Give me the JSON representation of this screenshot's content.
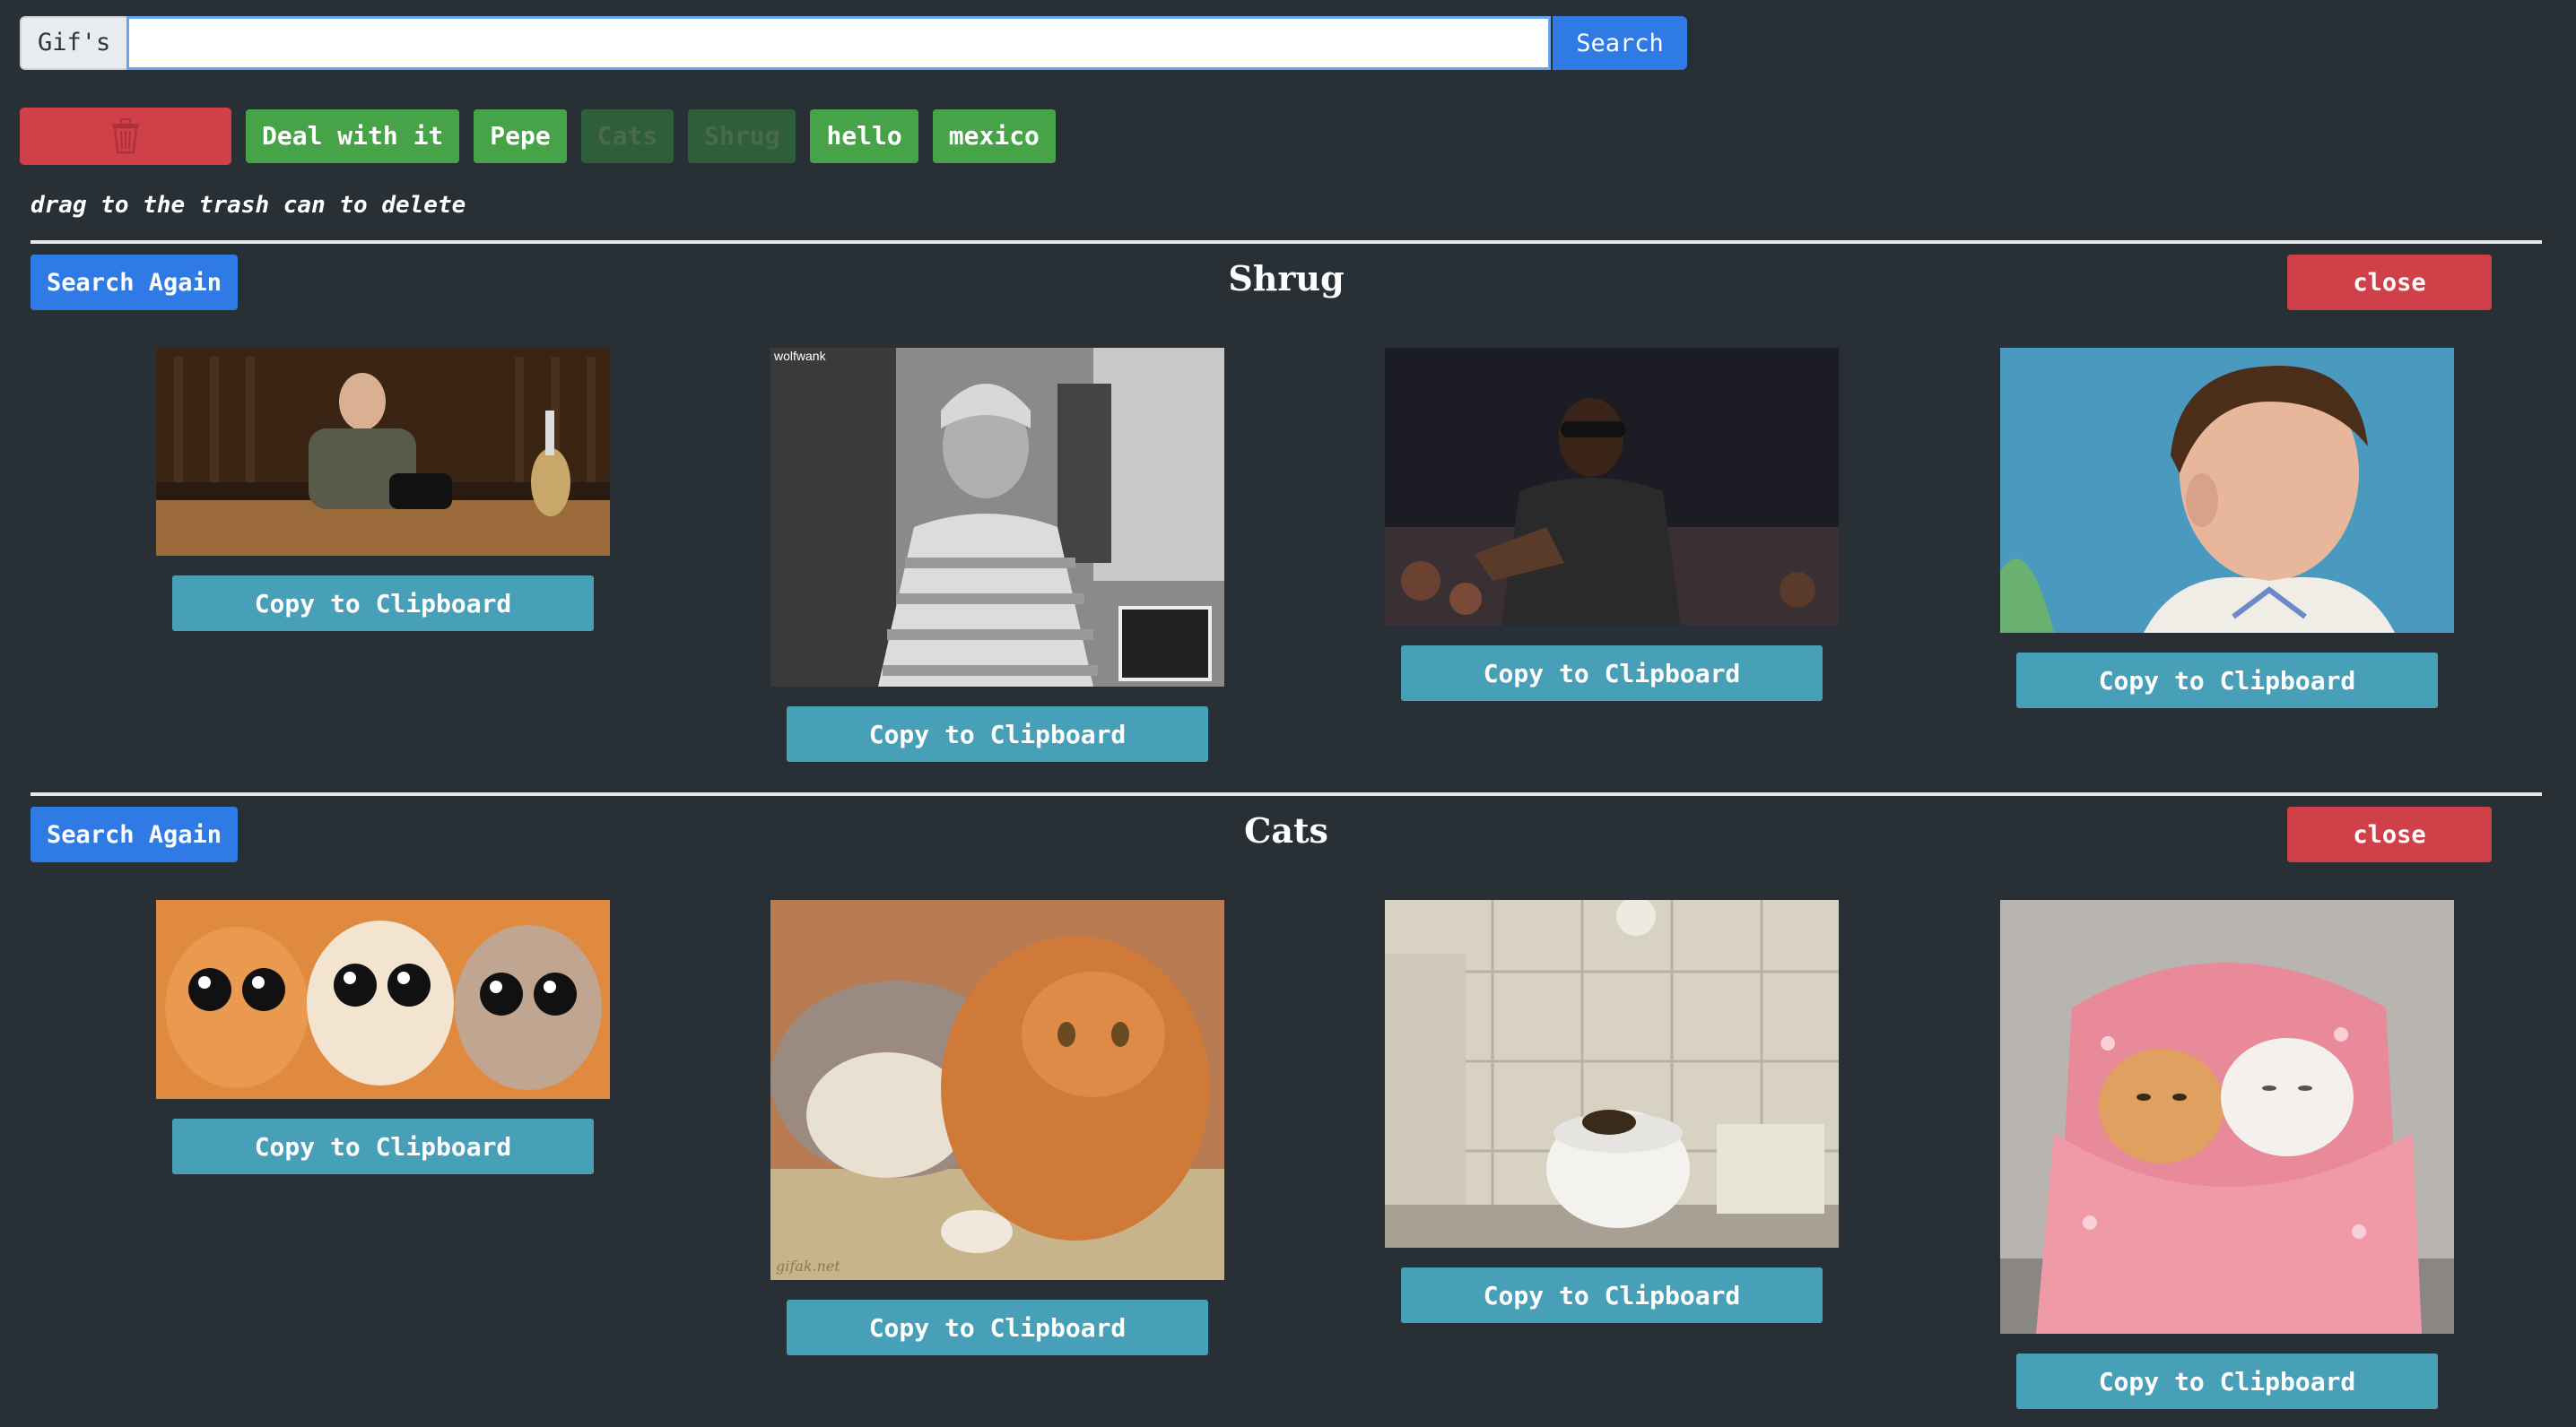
{
  "search": {
    "addon_label": "Gif's",
    "value": "",
    "placeholder": "",
    "button_label": "Search"
  },
  "tags": [
    {
      "label": "Deal with it",
      "faded": false
    },
    {
      "label": "Pepe",
      "faded": false
    },
    {
      "label": "Cats",
      "faded": true
    },
    {
      "label": "Shrug",
      "faded": true
    },
    {
      "label": "hello",
      "faded": false
    },
    {
      "label": "mexico",
      "faded": false
    }
  ],
  "hint": "drag to the trash can to delete",
  "sections": [
    {
      "title": "Shrug",
      "search_again_label": "Search Again",
      "close_label": "close",
      "gifs": [
        {
          "copy_label": "Copy to Clipboard",
          "watermark": ""
        },
        {
          "copy_label": "Copy to Clipboard",
          "watermark": "wolfwank"
        },
        {
          "copy_label": "Copy to Clipboard",
          "watermark": ""
        },
        {
          "copy_label": "Copy to Clipboard",
          "watermark": ""
        }
      ]
    },
    {
      "title": "Cats",
      "search_again_label": "Search Again",
      "close_label": "close",
      "gifs": [
        {
          "copy_label": "Copy to Clipboard",
          "watermark": ""
        },
        {
          "copy_label": "Copy to Clipboard",
          "watermark": "gifak.net"
        },
        {
          "copy_label": "Copy to Clipboard",
          "watermark": ""
        },
        {
          "copy_label": "Copy to Clipboard",
          "watermark": ""
        }
      ]
    }
  ],
  "colors": {
    "background": "#283035",
    "primary": "#2f7ae5",
    "danger": "#cf4049",
    "success": "#46a348",
    "info": "#48a0b8"
  },
  "icons": {
    "trash": "trash-icon"
  }
}
